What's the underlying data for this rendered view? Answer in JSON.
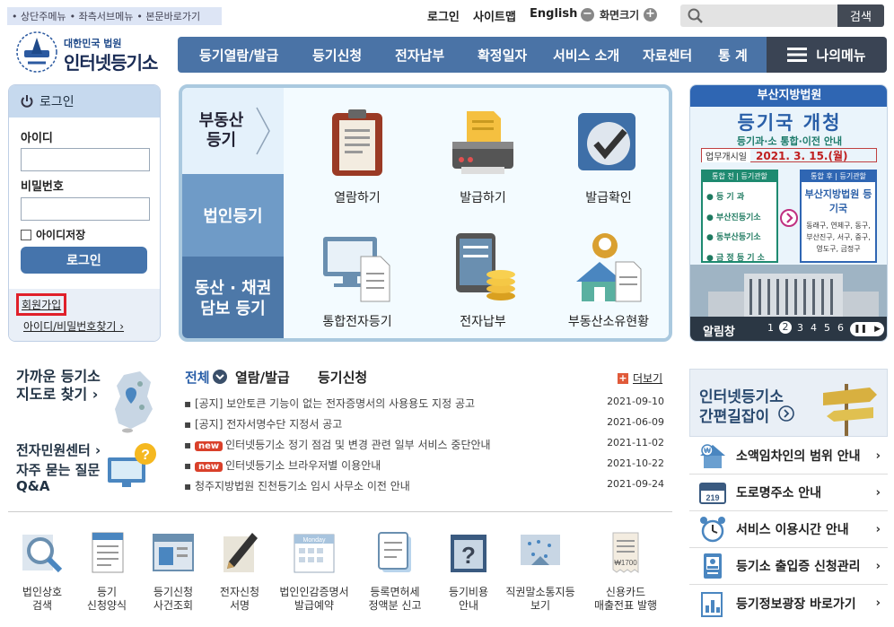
{
  "skip": {
    "items": [
      "상단주메뉴",
      "좌측서브메뉴",
      "본문바로가기"
    ]
  },
  "util": {
    "login": "로그인",
    "sitemap": "사이트맵",
    "english": "English",
    "screen_size": "화면크기"
  },
  "search": {
    "button": "검색",
    "placeholder": ""
  },
  "logo": {
    "top": "대한민국 법원",
    "main": "인터넷등기소"
  },
  "gnb": {
    "items": [
      "등기열람/발급",
      "등기신청",
      "전자납부",
      "확정일자",
      "서비스 소개",
      "자료센터",
      "통 계"
    ],
    "my_menu": "나의메뉴"
  },
  "login": {
    "title": "로그인",
    "id_label": "아이디",
    "pw_label": "비밀번호",
    "save_id": "아이디저장",
    "button": "로그인",
    "signup": "회원가입",
    "find": "아이디/비밀번호찾기 ›"
  },
  "main": {
    "categories": [
      "부동산 등기",
      "법인등기",
      "동산 · 채권 담보 등기"
    ],
    "services": [
      "열람하기",
      "발급하기",
      "발급확인",
      "통합전자등기",
      "전자납부",
      "부동산소유현황"
    ]
  },
  "banner": {
    "court": "부산지방법원",
    "title": "등기국 개청",
    "subtitle": "등기과·소 통합·이전 안내",
    "date_label": "업무개시일",
    "date": "2021. 3. 15.(월)",
    "before_title": "통합 전 | 등기관할",
    "before_items": [
      "등 기 과",
      "부산진등기소",
      "동부산등기소",
      "금 정 등 기 소"
    ],
    "after_title": "통합 후 | 등기관할",
    "after_court": "부산지방법원 등기국",
    "after_areas": "동래구, 연제구, 동구, 부산진구, 서구, 중구, 영도구, 금정구",
    "label": "알림창",
    "pages": [
      "1",
      "2",
      "3",
      "4",
      "5",
      "6"
    ]
  },
  "left_links": {
    "near_office": "가까운 등기소 지도로 찾기 ›",
    "near_office_line1": "가까운 등기소",
    "near_office_line2": "지도로 찾기 ›",
    "civil_center": "전자민원센터 ›",
    "faq_line1": "자주 묻는 질문",
    "faq_line2": "Q&A"
  },
  "notice": {
    "tabs": [
      "전체",
      "열람/발급",
      "등기신청"
    ],
    "more": "더보기",
    "items": [
      {
        "prefix": "",
        "text": "[공지] 보안토큰 기능이 없는 전자증명서의 사용용도 지정 공고",
        "date": "2021-09-10",
        "new": false
      },
      {
        "prefix": "",
        "text": "[공지] 전자서명수단 지정서 공고",
        "date": "2021-06-09",
        "new": false
      },
      {
        "prefix": "new",
        "text": "인터넷등기소 정기 점검 및 변경 관련 일부 서비스 중단안내",
        "date": "2021-11-02",
        "new": true
      },
      {
        "prefix": "new",
        "text": "인터넷등기소 브라우저별 이용안내",
        "date": "2021-10-22",
        "new": true
      },
      {
        "prefix": "",
        "text": "청주지방법원 진천등기소 임시 사무소 이전 안내",
        "date": "2021-09-24",
        "new": false
      }
    ]
  },
  "quick": [
    {
      "l1": "법인상호",
      "l2": "검색"
    },
    {
      "l1": "등기",
      "l2": "신청양식"
    },
    {
      "l1": "등기신청",
      "l2": "사건조회"
    },
    {
      "l1": "전자신청",
      "l2": "서명"
    },
    {
      "l1": "법인인감증명서",
      "l2": "발급예약"
    },
    {
      "l1": "등록면허세",
      "l2": "정액분 신고"
    },
    {
      "l1": "등기비용",
      "l2": "안내"
    },
    {
      "l1": "직권말소통지등",
      "l2": "보기"
    },
    {
      "l1": "신용카드",
      "l2": "매출전표 발행"
    }
  ],
  "quick_icon_texts": {
    "monday": "Monday",
    "price": "₩1700"
  },
  "guide": {
    "line1": "인터넷등기소",
    "line2": "간편길잡이"
  },
  "right_list": [
    "소액임차인의 범위 안내",
    "도로명주소 안내",
    "서비스 이용시간 안내",
    "등기소 출입증 신청관리",
    "등기정보광장 바로가기"
  ],
  "right_icon_texts": {
    "won": "₩",
    "zip": "219"
  },
  "colors": {
    "nav": "#4a73a6",
    "my_menu": "#3a4454",
    "signup_highlight": "#e0202a",
    "new_badge": "#d9402a",
    "banner_title": "#2a5fa8"
  }
}
